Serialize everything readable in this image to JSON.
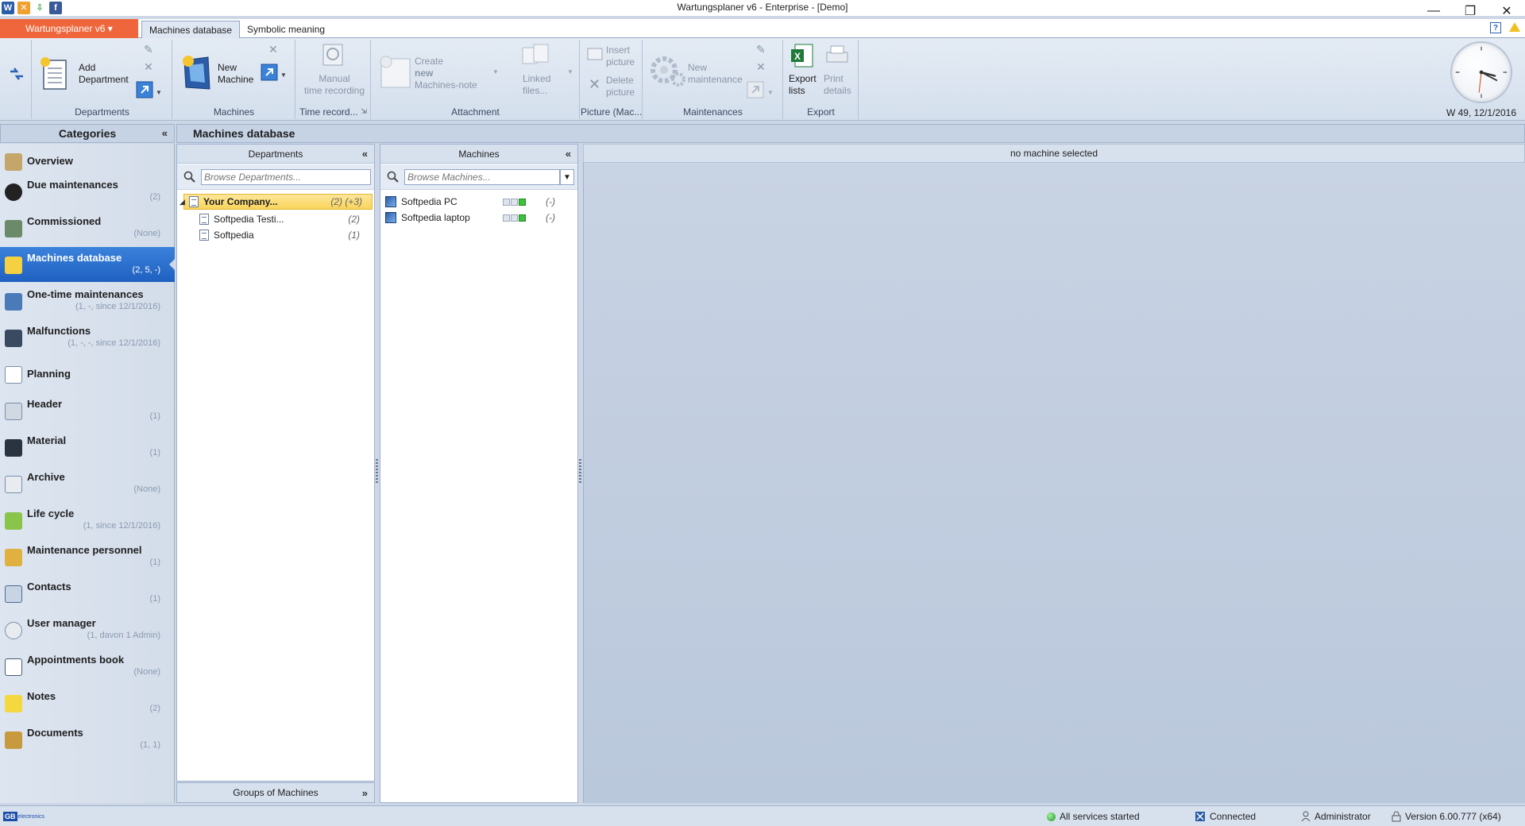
{
  "window": {
    "title": "Wartungsplaner v6 - Enterprise - [Demo]"
  },
  "tabs": {
    "app_menu": "Wartungsplaner v6 ▾",
    "items": [
      "Machines database",
      "Symbolic meaning"
    ]
  },
  "ribbon": {
    "departments": {
      "add_line1": "Add",
      "add_line2": "Department",
      "group": "Departments"
    },
    "machines": {
      "new_line1": "New",
      "new_line2": "Machine",
      "group": "Machines"
    },
    "time_record": {
      "line1": "Manual",
      "line2": "time recording",
      "group": "Time record..."
    },
    "attachment": {
      "create_line1": "Create",
      "create_line2": "new",
      "create_line3": "Machines-note",
      "linked_line1": "Linked",
      "linked_line2": "files...",
      "group": "Attachment"
    },
    "picture": {
      "insert_line1": "Insert",
      "insert_line2": "picture",
      "delete_line1": "Delete",
      "delete_line2": "picture",
      "group": "Picture (Mac..."
    },
    "maintenances": {
      "new_line1": "New",
      "new_line2": "maintenance",
      "group": "Maintenances"
    },
    "export": {
      "export_line1": "Export",
      "export_line2": "lists",
      "print_line1": "Print",
      "print_line2": "details",
      "group": "Export"
    }
  },
  "clock": {
    "label": "W 49, 12/1/2016"
  },
  "categories": {
    "header": "Categories",
    "items": [
      {
        "label": "Overview",
        "count": ""
      },
      {
        "label": "Due maintenances",
        "count": "(2)"
      },
      {
        "label": "Commissioned",
        "count": "(None)"
      },
      {
        "label": "Machines database",
        "count": "(2, 5, -)"
      },
      {
        "label": "One-time maintenances",
        "count": "(1, -, since 12/1/2016)"
      },
      {
        "label": "Malfunctions",
        "count": "(1, -, -, since 12/1/2016)"
      },
      {
        "label": "Planning",
        "count": ""
      },
      {
        "label": "Header",
        "count": "(1)"
      },
      {
        "label": "Material",
        "count": "(1)"
      },
      {
        "label": "Archive",
        "count": "(None)"
      },
      {
        "label": "Life cycle",
        "count": "(1, since 12/1/2016)"
      },
      {
        "label": "Maintenance personnel",
        "count": "(1)"
      },
      {
        "label": "Contacts",
        "count": "(1)"
      },
      {
        "label": "User manager",
        "count": "(1, davon 1 Admin)"
      },
      {
        "label": "Appointments book",
        "count": "(None)"
      },
      {
        "label": "Notes",
        "count": "(2)"
      },
      {
        "label": "Documents",
        "count": "(1, 1)"
      }
    ]
  },
  "main": {
    "header": "Machines database",
    "departments": {
      "title": "Departments",
      "search_placeholder": "Browse Departments...",
      "tree": [
        {
          "label": "Your Company...",
          "count": "(2) (+3)"
        },
        {
          "label": "Softpedia Testi...",
          "count": "(2)"
        },
        {
          "label": "Softpedia",
          "count": "(1)"
        }
      ]
    },
    "machines": {
      "title": "Machines",
      "search_placeholder": "Browse Machines...",
      "items": [
        {
          "label": "Softpedia PC",
          "count": "(-)"
        },
        {
          "label": "Softpedia laptop",
          "count": "(-)"
        }
      ]
    },
    "detail": {
      "title": "no machine selected"
    },
    "groups_footer": "Groups of Machines"
  },
  "status": {
    "services": "All services started",
    "connection": "Connected",
    "user": "Administrator",
    "version": "Version 6.00.777 (x64)"
  },
  "colors": {
    "accent": "#f0663c",
    "selection": "#2a6fd0",
    "highlight": "#f9d45a"
  }
}
